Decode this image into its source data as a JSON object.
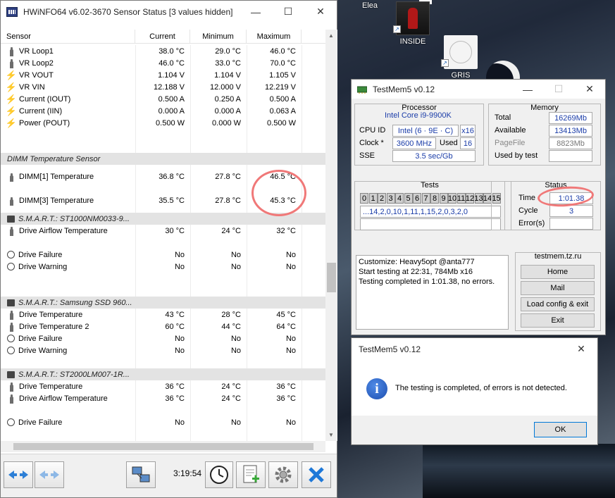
{
  "desktop": {
    "icons": [
      {
        "label": "Elea"
      },
      {
        "label": "INSIDE"
      },
      {
        "label": "GRIS"
      }
    ]
  },
  "hwinfo": {
    "title": "HWiNFO64 v6.02-3670 Sensor Status [3 values hidden]",
    "columns": {
      "sensor": "Sensor",
      "current": "Current",
      "minimum": "Minimum",
      "maximum": "Maximum"
    },
    "rows": [
      {
        "type": "sensor",
        "icon": "thermometer-icon",
        "name": "VR Loop1",
        "cur": "38.0 °C",
        "min": "29.0 °C",
        "max": "46.0 °C"
      },
      {
        "type": "sensor",
        "icon": "thermometer-icon",
        "name": "VR Loop2",
        "cur": "46.0 °C",
        "min": "33.0 °C",
        "max": "70.0 °C"
      },
      {
        "type": "sensor",
        "icon": "lightning-icon",
        "name": "VR VOUT",
        "cur": "1.104 V",
        "min": "1.104 V",
        "max": "1.105 V"
      },
      {
        "type": "sensor",
        "icon": "lightning-icon",
        "name": "VR VIN",
        "cur": "12.188 V",
        "min": "12.000 V",
        "max": "12.219 V"
      },
      {
        "type": "sensor",
        "icon": "lightning-icon",
        "name": "Current (IOUT)",
        "cur": "0.500 A",
        "min": "0.250 A",
        "max": "0.500 A"
      },
      {
        "type": "sensor",
        "icon": "lightning-icon",
        "name": "Current (IIN)",
        "cur": "0.000 A",
        "min": "0.000 A",
        "max": "0.063 A"
      },
      {
        "type": "sensor",
        "icon": "lightning-icon",
        "name": "Power (POUT)",
        "cur": "0.500 W",
        "min": "0.000 W",
        "max": "0.500 W"
      },
      {
        "type": "blank"
      },
      {
        "type": "blank"
      },
      {
        "type": "group",
        "icon": "",
        "name": "DIMM Temperature Sensor"
      },
      {
        "type": "tall",
        "icon": "thermometer-icon",
        "name": "DIMM[1] Temperature",
        "cur": "36.8 °C",
        "min": "27.8 °C",
        "max": "46.5 °C"
      },
      {
        "type": "tall",
        "icon": "thermometer-icon",
        "name": "DIMM[3] Temperature",
        "cur": "35.5 °C",
        "min": "27.8 °C",
        "max": "45.3 °C"
      },
      {
        "type": "group",
        "icon": "disk-icon",
        "name": "S.M.A.R.T.: ST1000NM0033-9..."
      },
      {
        "type": "sensor",
        "icon": "thermometer-icon",
        "name": "Drive Airflow Temperature",
        "cur": "30 °C",
        "min": "24 °C",
        "max": "32 °C"
      },
      {
        "type": "blank"
      },
      {
        "type": "sensor",
        "icon": "clock-icon",
        "name": "Drive Failure",
        "cur": "No",
        "min": "No",
        "max": "No"
      },
      {
        "type": "sensor",
        "icon": "clock-icon",
        "name": "Drive Warning",
        "cur": "No",
        "min": "No",
        "max": "No"
      },
      {
        "type": "blank"
      },
      {
        "type": "blank"
      },
      {
        "type": "group",
        "icon": "disk-icon",
        "name": "S.M.A.R.T.: Samsung SSD 960..."
      },
      {
        "type": "sensor",
        "icon": "thermometer-icon",
        "name": "Drive Temperature",
        "cur": "43 °C",
        "min": "28 °C",
        "max": "45 °C"
      },
      {
        "type": "sensor",
        "icon": "thermometer-icon",
        "name": "Drive Temperature 2",
        "cur": "60 °C",
        "min": "44 °C",
        "max": "64 °C"
      },
      {
        "type": "sensor",
        "icon": "clock-icon",
        "name": "Drive Failure",
        "cur": "No",
        "min": "No",
        "max": "No"
      },
      {
        "type": "sensor",
        "icon": "clock-icon",
        "name": "Drive Warning",
        "cur": "No",
        "min": "No",
        "max": "No"
      },
      {
        "type": "blank"
      },
      {
        "type": "group",
        "icon": "disk-icon",
        "name": "S.M.A.R.T.: ST2000LM007-1R..."
      },
      {
        "type": "sensor",
        "icon": "thermometer-icon",
        "name": "Drive Temperature",
        "cur": "36 °C",
        "min": "24 °C",
        "max": "36 °C"
      },
      {
        "type": "sensor",
        "icon": "thermometer-icon",
        "name": "Drive Airflow Temperature",
        "cur": "36 °C",
        "min": "24 °C",
        "max": "36 °C"
      },
      {
        "type": "blank"
      },
      {
        "type": "sensor",
        "icon": "clock-icon",
        "name": "Drive Failure",
        "cur": "No",
        "min": "No",
        "max": "No"
      }
    ],
    "toolbar": {
      "elapsed": "3:19:54"
    }
  },
  "testmem5": {
    "title": "TestMem5 v0.12",
    "processor": {
      "title": "Processor",
      "name": "Intel Core i9-9900K",
      "cpu_id_label": "CPU ID",
      "cpu_id": "Intel (6 · 9E · C)",
      "threads": "x16",
      "clock_label": "Clock *",
      "clock": "3600 MHz",
      "used_label": "Used",
      "used": "16",
      "sse_label": "SSE",
      "sse": "3.5 sec/Gb"
    },
    "memory": {
      "title": "Memory",
      "total_label": "Total",
      "total": "16269Mb",
      "available_label": "Available",
      "available": "13413Mb",
      "pagefile_label": "PageFile",
      "pagefile": "8823Mb",
      "usedbytest_label": "Used by test",
      "usedbytest": ""
    },
    "tests": {
      "title": "Tests",
      "cells": [
        "0",
        "1",
        "2",
        "3",
        "4",
        "5",
        "6",
        "7",
        "8",
        "9",
        "10",
        "11",
        "12",
        "13",
        "14",
        "15"
      ],
      "sequence": "...14,2,0,10,1,11,1,15,2,0,3,2,0"
    },
    "status": {
      "title": "Status",
      "time_label": "Time",
      "time": "1:01.38",
      "cycle_label": "Cycle",
      "cycle": "3",
      "errors_label": "Error(s)",
      "errors": ""
    },
    "log": "Customize: Heavy5opt @anta777\nStart testing at 22:31, 784Mb x16\nTesting completed in 1:01.38, no errors.",
    "links": {
      "title": "testmem.tz.ru",
      "home": "Home",
      "mail": "Mail",
      "load": "Load config & exit",
      "exit": "Exit"
    }
  },
  "dialog": {
    "title": "TestMem5 v0.12",
    "message": "The testing is completed, of errors is not detected.",
    "ok": "OK"
  }
}
